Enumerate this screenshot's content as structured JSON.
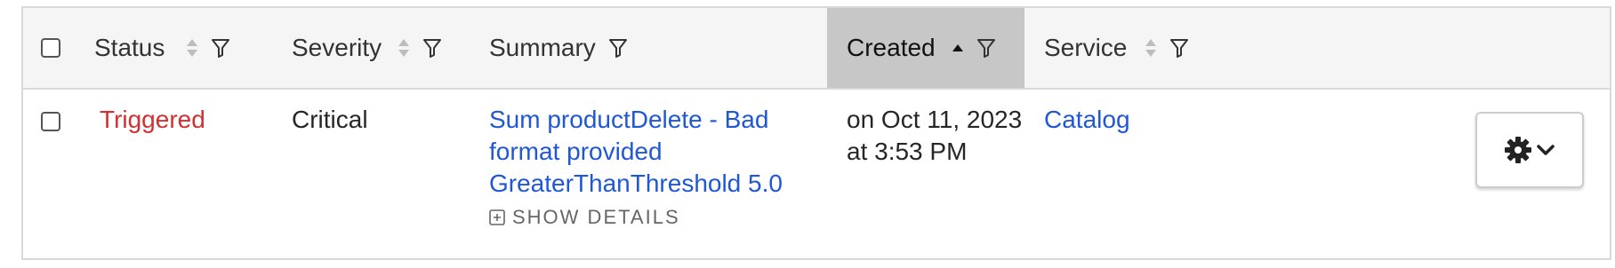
{
  "columns": {
    "status": "Status",
    "severity": "Severity",
    "summary": "Summary",
    "created": "Created",
    "service": "Service"
  },
  "row": {
    "status": "Triggered",
    "severity": "Critical",
    "summary_lines": [
      "Sum productDelete - Bad",
      "format provided",
      "GreaterThanThreshold 5.0"
    ],
    "show_details": "SHOW DETAILS",
    "created_lines": [
      "on Oct 11, 2023",
      "at 3:53 PM"
    ],
    "service": "Catalog"
  },
  "icons": {
    "sort": "sort-updown-icon",
    "sort_active": "sort-ascending-icon",
    "filter": "filter-icon",
    "expand": "plus-square-icon",
    "gear": "gear-icon",
    "chevron": "chevron-down-icon"
  },
  "colors": {
    "link": "#1f57d6",
    "triggered": "#d32f2f",
    "sorted_header": "#c7c7c7"
  },
  "sorted_column": "created"
}
